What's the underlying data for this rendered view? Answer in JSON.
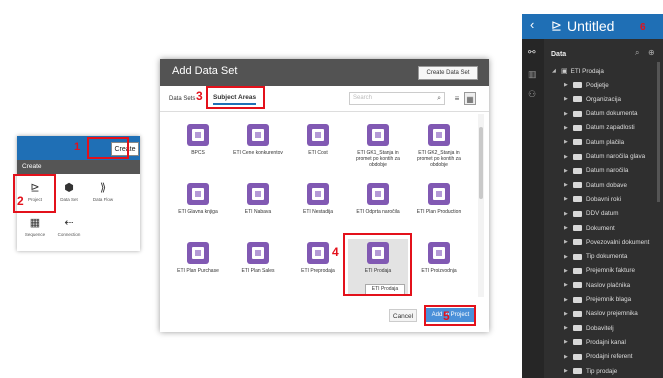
{
  "create_panel": {
    "create_button": "Create",
    "menu_label": "Create",
    "items": [
      {
        "label": "Project",
        "icon": "project-icon",
        "glyph": "⊵"
      },
      {
        "label": "Data Set",
        "icon": "data-set-icon",
        "glyph": "⬢"
      },
      {
        "label": "Data Flow",
        "icon": "data-flow-icon",
        "glyph": "⟫"
      },
      {
        "label": "Sequence",
        "icon": "sequence-icon",
        "glyph": "▦"
      },
      {
        "label": "Connection",
        "icon": "connection-icon",
        "glyph": "⇠"
      }
    ]
  },
  "dialog": {
    "title": "Add Data Set",
    "create_data_set_button": "Create Data Set",
    "tabs": [
      "Data Sets",
      "Subject Areas"
    ],
    "search_placeholder": "Search",
    "subject_areas": [
      "BPCS",
      "ETI Cene konkurentov",
      "ETI Cost",
      "ETI GK1_Stanja in promet po kontih za obdobje",
      "ETI GK2_Stanja in promet po kontih za obdobje",
      "ETI Glavna knjiga",
      "ETI Nabava",
      "ETI Nestadija",
      "ETI Odprta naročila",
      "ETI Plan Production",
      "ETI Plan Purchase",
      "ETI Plan Sales",
      "ETI Preprodaja",
      "ETI Prodaja",
      "ETI Proizvodnja"
    ],
    "tooltip": "ETI Prodaja",
    "cancel_button": "Cancel",
    "add_button": "Add to Project"
  },
  "right_panel": {
    "title": "Untitled",
    "section": "Data",
    "root": "ETI Prodaja",
    "folders": [
      "Podjetje",
      "Organizacija",
      "Datum dokumenta",
      "Datum zapadlosti",
      "Datum plačila",
      "Datum naročila glava",
      "Datum naročila",
      "Datum dobave",
      "Dobavni roki",
      "DDV datum",
      "Dokument",
      "Povezovalni dokument",
      "Tip dokumenta",
      "Prejemnik fakture",
      "Naslov plačnika",
      "Prejemnik blaga",
      "Naslov prejemnika",
      "Dobavitelj",
      "Prodajni kanal",
      "Prodajni referent",
      "Tip prodaje"
    ]
  },
  "annotations": [
    "1",
    "2",
    "3",
    "4",
    "5",
    "6"
  ],
  "colors": {
    "accent": "#1f6fb5",
    "annotation": "#e3111b",
    "subject_area_icon": "#8159b3",
    "panel_dark": "#2f2f2f"
  }
}
